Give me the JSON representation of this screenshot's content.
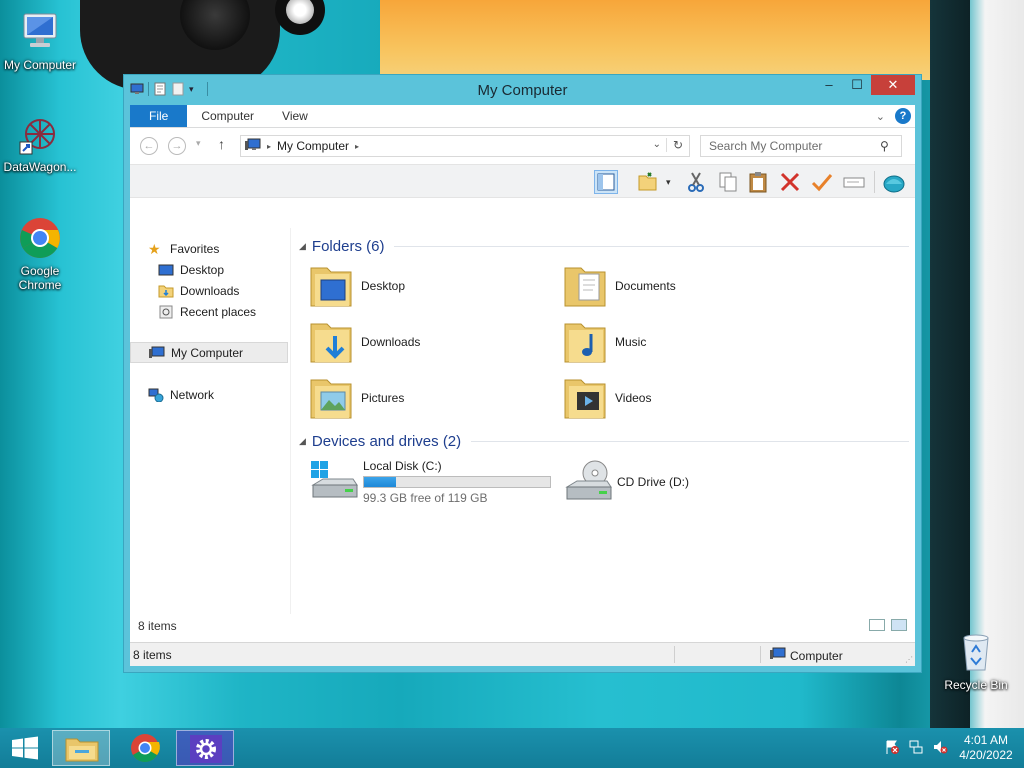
{
  "desktop": {
    "icons": [
      {
        "label": "My Computer"
      },
      {
        "label": "DataWagon..."
      },
      {
        "label": "Google Chrome"
      },
      {
        "label": "Recycle Bin"
      }
    ]
  },
  "window": {
    "title": "My Computer",
    "ribbon_tabs": [
      "File",
      "Computer",
      "View"
    ],
    "address": {
      "crumb": "My Computer"
    },
    "search": {
      "placeholder": "Search My Computer"
    }
  },
  "nav_pane": {
    "favorites": "Favorites",
    "items": [
      "Desktop",
      "Downloads",
      "Recent places"
    ],
    "computer": "My Computer",
    "network": "Network"
  },
  "content": {
    "folders_header": "Folders (6)",
    "folders": [
      "Desktop",
      "Documents",
      "Downloads",
      "Music",
      "Pictures",
      "Videos"
    ],
    "drives_header": "Devices and drives (2)",
    "drives": [
      {
        "name": "Local Disk (C:)",
        "free": "99.3 GB free of 119 GB",
        "used_fraction": 0.17
      },
      {
        "name": "CD Drive (D:)"
      }
    ]
  },
  "status": {
    "items_inner": "8 items",
    "items_bar": "8 items",
    "zone": "Computer"
  },
  "taskbar": {
    "time": "4:01 AM",
    "date": "4/20/2022"
  },
  "colors": {
    "accent": "#1979ca",
    "close": "#c7403a",
    "window_frame": "#5bc3da",
    "taskbar": "#1a91ad"
  }
}
